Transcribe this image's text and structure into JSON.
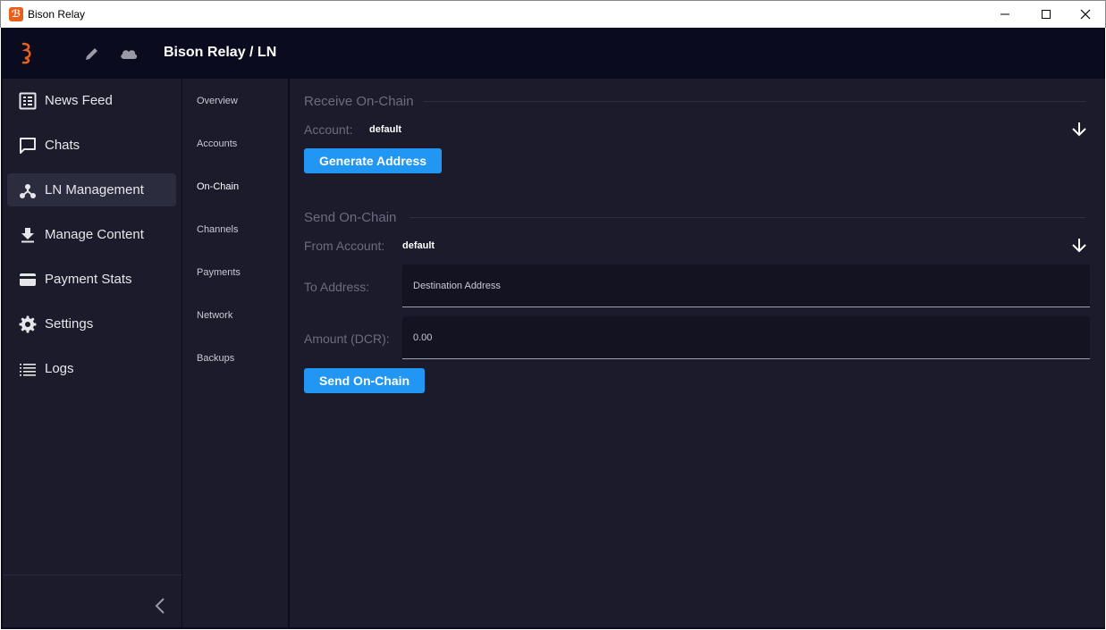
{
  "window": {
    "title": "Bison Relay",
    "controls": [
      "minimize-icon",
      "maximize-icon",
      "close-icon"
    ]
  },
  "header": {
    "title": "Bison Relay / LN",
    "icons": [
      "bison-relay-logo",
      "pencil-icon",
      "cloud-icon"
    ]
  },
  "sidebar": {
    "items": [
      {
        "label": "News Feed",
        "icon": "news-feed-icon",
        "active": false
      },
      {
        "label": "Chats",
        "icon": "chat-icon",
        "active": false
      },
      {
        "label": "LN Management",
        "icon": "ln-network-icon",
        "active": true
      },
      {
        "label": "Manage Content",
        "icon": "download-icon",
        "active": false
      },
      {
        "label": "Payment Stats",
        "icon": "card-icon",
        "active": false
      },
      {
        "label": "Settings",
        "icon": "gear-icon",
        "active": false
      },
      {
        "label": "Logs",
        "icon": "logs-icon",
        "active": false
      }
    ],
    "collapse_icon": "chevron-left-icon"
  },
  "subnav": {
    "items": [
      {
        "label": "Overview",
        "active": false
      },
      {
        "label": "Accounts",
        "active": false
      },
      {
        "label": "On-Chain",
        "active": true
      },
      {
        "label": "Channels",
        "active": false
      },
      {
        "label": "Payments",
        "active": false
      },
      {
        "label": "Network",
        "active": false
      },
      {
        "label": "Backups",
        "active": false
      }
    ]
  },
  "receive": {
    "title": "Receive On-Chain",
    "account_label": "Account:",
    "account_value": "default",
    "button_label": "Generate Address"
  },
  "send": {
    "title": "Send On-Chain",
    "from_label": "From Account:",
    "from_value": "default",
    "to_label": "To Address:",
    "to_placeholder": "Destination Address",
    "amount_label": "Amount (DCR):",
    "amount_value": "0.00",
    "button_label": "Send On-Chain"
  },
  "colors": {
    "accent": "#2196f3",
    "header_bg": "#0b0b1f",
    "panel_bg": "#1b1b2c",
    "active_item_bg": "#2c2c3f",
    "brand": "#e8601c"
  }
}
